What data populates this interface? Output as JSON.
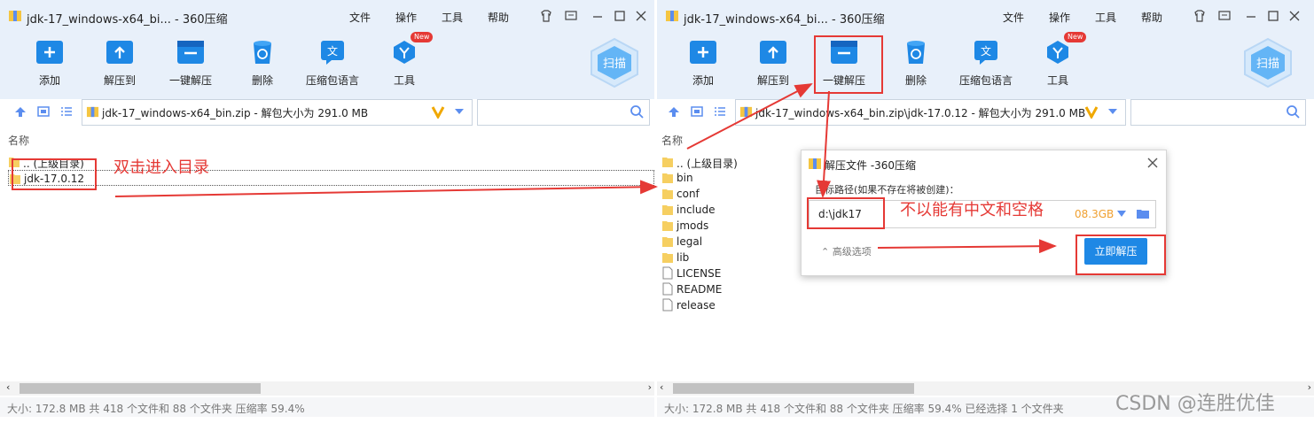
{
  "left_window": {
    "title": "jdk-17_windows-x64_bi... - 360压缩",
    "menu": [
      "文件",
      "操作",
      "工具",
      "帮助"
    ],
    "toolbar": {
      "add": "添加",
      "extract_to": "解压到",
      "one_click": "一键解压",
      "delete": "删除",
      "comment": "压缩包语言",
      "tools": "工具",
      "new_badge": "New",
      "scan": "扫描"
    },
    "address": "jdk-17_windows-x64_bin.zip - 解包大小为 291.0 MB",
    "column_name": "名称",
    "files": [
      {
        "name": ".. (上级目录)",
        "type": "folder"
      },
      {
        "name": "jdk-17.0.12",
        "type": "folder"
      }
    ],
    "status": "大小: 172.8 MB 共 418 个文件和 88 个文件夹 压缩率 59.4%"
  },
  "right_window": {
    "title": "jdk-17_windows-x64_bi... - 360压缩",
    "menu": [
      "文件",
      "操作",
      "工具",
      "帮助"
    ],
    "toolbar": {
      "add": "添加",
      "extract_to": "解压到",
      "one_click": "一键解压",
      "delete": "删除",
      "comment": "压缩包语言",
      "tools": "工具",
      "new_badge": "New",
      "scan": "扫描"
    },
    "address": "jdk-17_windows-x64_bin.zip\\jdk-17.0.12 - 解包大小为 291.0 MB",
    "column_name": "名称",
    "files": [
      {
        "name": ".. (上级目录)",
        "type": "folder"
      },
      {
        "name": "bin",
        "type": "folder"
      },
      {
        "name": "conf",
        "type": "folder"
      },
      {
        "name": "include",
        "type": "folder"
      },
      {
        "name": "jmods",
        "type": "folder"
      },
      {
        "name": "legal",
        "type": "folder"
      },
      {
        "name": "lib",
        "type": "folder"
      },
      {
        "name": "LICENSE",
        "type": "file"
      },
      {
        "name": "README",
        "type": "file"
      },
      {
        "name": "release",
        "type": "file"
      }
    ],
    "status": "大小: 172.8 MB 共 418 个文件和 88 个文件夹 压缩率 59.4% 已经选择 1 个文件夹"
  },
  "dialog": {
    "title": "解压文件 -360压缩",
    "target_label": "目标路径(如果不存在将被创建)：",
    "path_value": "d:\\jdk17",
    "free_space": "08.3GB",
    "advanced": "高级选项",
    "extract_now": "立即解压"
  },
  "annotations": {
    "double_click": "双击进入目录",
    "no_chinese": "不以能有中文和空格"
  },
  "watermark": "CSDN @连胜优佳",
  "colors": {
    "accent": "#1e88e5",
    "annotation_red": "#e53935",
    "toolbar_bg": "#e8f0fa"
  }
}
